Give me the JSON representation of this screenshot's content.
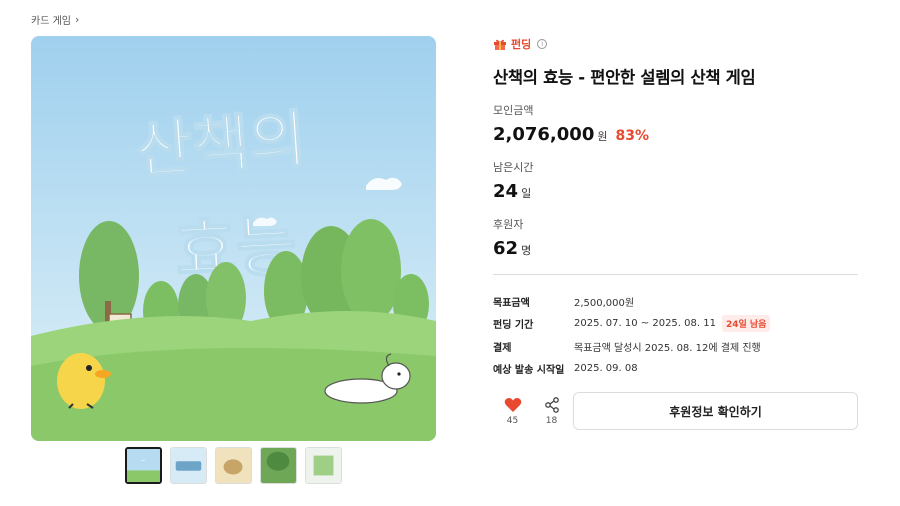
{
  "breadcrumb": {
    "label": "카드 게임"
  },
  "product": {
    "category": "펀딩",
    "title": "산책의 효능 - 편안한 설렘의 산책 게임",
    "cover_text": [
      "산책의",
      "효능"
    ]
  },
  "stats": {
    "raised": {
      "label": "모인금액",
      "value": "2,076,000",
      "unit": "원",
      "percent": "83%"
    },
    "remaining": {
      "label": "남은시간",
      "value": "24",
      "unit": "일"
    },
    "backers": {
      "label": "후원자",
      "value": "62",
      "unit": "명"
    }
  },
  "details": {
    "goal": {
      "label": "목표금액",
      "value": "2,500,000원"
    },
    "period": {
      "label": "펀딩 기간",
      "value": "2025. 07. 10 ~ 2025. 08. 11",
      "badge": "24일 남음"
    },
    "payment": {
      "label": "결제",
      "value": "목표금액 달성시 2025. 08. 12에 결제 진행"
    },
    "shipping": {
      "label": "예상 발송 시작일",
      "value": "2025. 09. 08"
    }
  },
  "actions": {
    "like_count": "45",
    "share_count": "18",
    "support_button": "후원정보 확인하기"
  },
  "colors": {
    "accent": "#e8492f",
    "sky": "#a8d4ef",
    "grass": "#8ac86a"
  },
  "icons": [
    "chevron-right-icon",
    "gift-icon",
    "info-icon",
    "heart-icon",
    "share-icon"
  ]
}
